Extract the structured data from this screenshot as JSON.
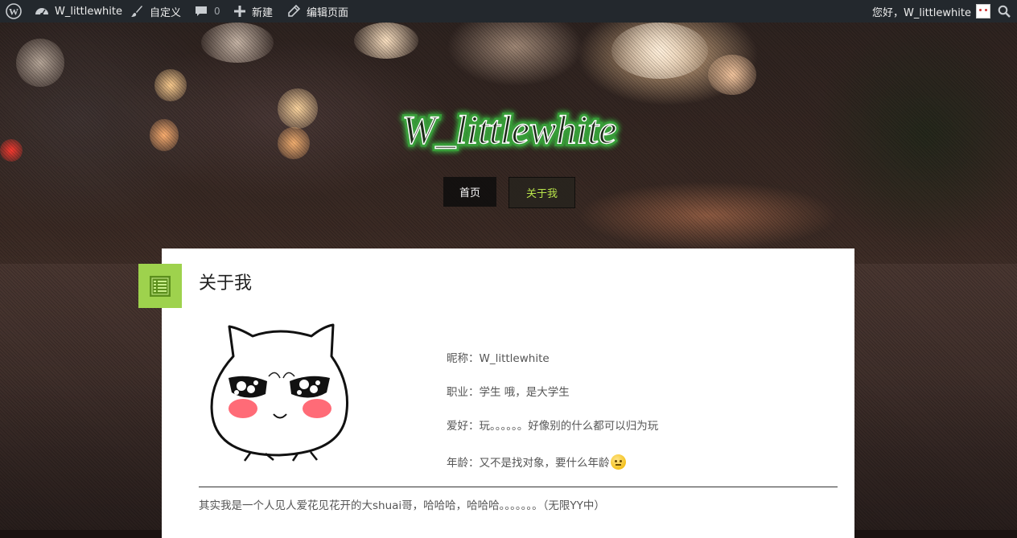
{
  "admin_bar": {
    "site_name": "W_littlewhite",
    "customize": "自定义",
    "comments_count": "0",
    "new": "新建",
    "edit_page": "编辑页面",
    "greeting": "您好，W_littlewhite"
  },
  "site": {
    "logo_text": "W_littlewhite"
  },
  "nav": {
    "items": [
      {
        "label": "首页"
      },
      {
        "label": "关于我"
      }
    ],
    "active_label_color": "#b7e24a"
  },
  "post": {
    "title": "关于我",
    "nickname": "昵称：W_littlewhite",
    "occupation": "职业：学生  哦，是大学生",
    "hobby": "爱好：玩。。。。。。好像别的什么都可以归为玩",
    "age": "年龄：又不是找对象，要什么年龄",
    "body": "其实我是一个人见人爱花见花开的大shuai哥，哈哈哈，哈哈哈。。。。。。。（无限YY中）"
  },
  "colors": {
    "admin_bar_bg": "#23282d",
    "accent_green": "#9ed24d",
    "logo_glow": "#29d33b"
  }
}
